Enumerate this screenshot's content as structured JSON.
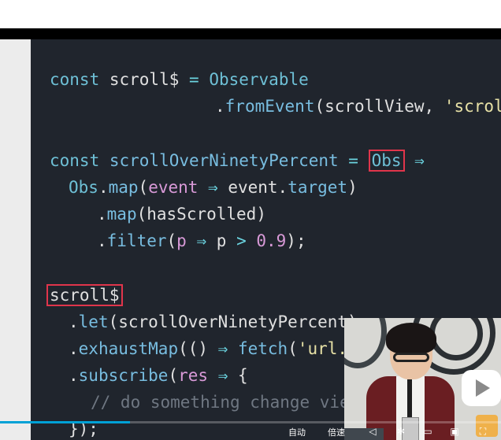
{
  "code": {
    "lines": {
      "l1": {
        "kw": "const ",
        "var": "scroll$",
        "eq": " = ",
        "ty": "Observable"
      },
      "l2": {
        "dot": ".",
        "fn": "fromEvent",
        "open": "(scrollView, ",
        "str": "'scroll"
      },
      "l4": {
        "kw": "const ",
        "name": "scrollOverNinetyPercent",
        "eq": " = ",
        "hl": "Obs",
        "arrow": " ⇒"
      },
      "l5": {
        "ty": "Obs",
        "dot": ".",
        "fn": "map",
        "open": "(",
        "p": "event",
        "arrow": " ⇒ ",
        "rest": "event.",
        "prop": "target",
        "close": ")"
      },
      "l6": {
        "dot": ".",
        "fn": "map",
        "open": "(",
        "arg": "hasScrolled",
        "close": ")"
      },
      "l7": {
        "dot": ".",
        "fn": "filter",
        "open": "(",
        "p": "p",
        "arrow": " ⇒ ",
        "p2": "p ",
        "gt": ">",
        "num": " 0.9",
        "close": ");"
      },
      "l9": {
        "hl": "scroll$"
      },
      "l10": {
        "dot": ".",
        "fn": "let",
        "open": "(",
        "arg": "scrollOverNinetyPercent",
        "close": ")"
      },
      "l11": {
        "dot": ".",
        "fn": "exhaustMap",
        "open": "(() ",
        "arrow": "⇒ ",
        "fetch": "fetch",
        "paren": "(",
        "str": "'url."
      },
      "l12": {
        "dot": ".",
        "fn": "subscribe",
        "open": "(",
        "p": "res",
        "arrow": " ⇒ ",
        "brace": "{"
      },
      "l13": {
        "comment": "// do something change view"
      },
      "l14": {
        "close": "});"
      }
    }
  },
  "player": {
    "progress_percent": 26,
    "controls": {
      "label_a": "自动",
      "label_b": "倍速"
    }
  }
}
